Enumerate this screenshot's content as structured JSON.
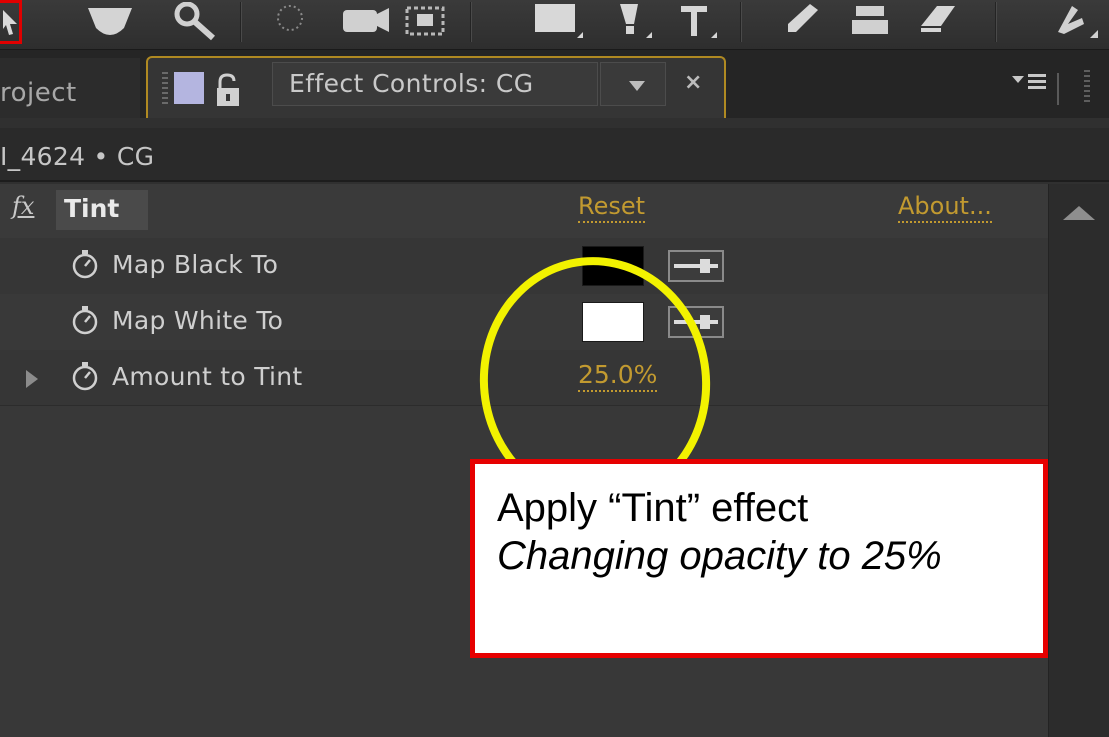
{
  "toolbar": {
    "tools": [
      "selection-tool",
      "hand-tool",
      "zoom-tool",
      "rotation-tool",
      "camera-tool",
      "pan-behind-tool",
      "rectangle-tool",
      "pen-tool",
      "type-tool",
      "brush-tool",
      "clone-stamp-tool",
      "eraser-tool",
      "puppet-tool"
    ]
  },
  "tabs": {
    "project_label": "roject",
    "effect_controls_title": "Effect Controls: CG",
    "close_glyph": "×",
    "label_color": "#b4b5e0"
  },
  "breadcrumb": "I_4624 • CG",
  "effect": {
    "fx_badge": "fx",
    "name": "Tint",
    "reset_label": "Reset",
    "about_label": "About..."
  },
  "properties": {
    "map_black": {
      "label": "Map Black To",
      "color": "#000000"
    },
    "map_white": {
      "label": "Map White To",
      "color": "#ffffff"
    },
    "amount": {
      "label": "Amount to Tint",
      "value": "25.0%"
    }
  },
  "accent_color": "#c29a30",
  "annotation": {
    "line1": "Apply “Tint” effect",
    "line2": "Changing opacity to 25%",
    "border_color": "#e60000",
    "circle_color": "#f2f200"
  }
}
